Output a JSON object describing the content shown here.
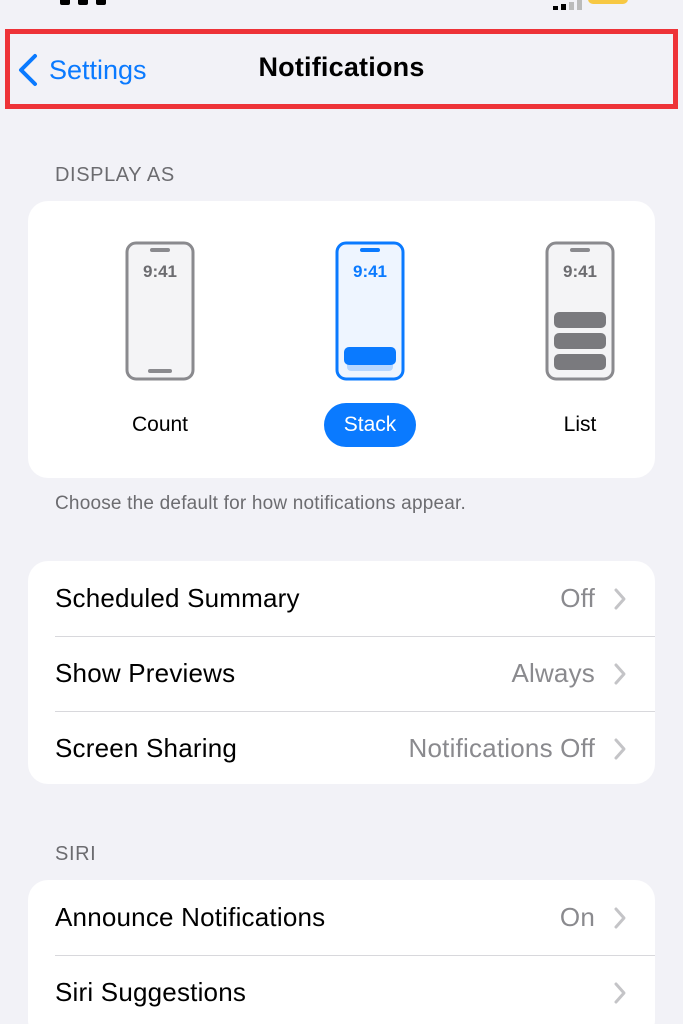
{
  "nav": {
    "back_label": "Settings",
    "title": "Notifications"
  },
  "display_as": {
    "header": "DISPLAY AS",
    "time": "9:41",
    "options": [
      {
        "label": "Count",
        "selected": false
      },
      {
        "label": "Stack",
        "selected": true
      },
      {
        "label": "List",
        "selected": false
      }
    ],
    "footer": "Choose the default for how notifications appear."
  },
  "preferences": {
    "rows": [
      {
        "label": "Scheduled Summary",
        "value": "Off"
      },
      {
        "label": "Show Previews",
        "value": "Always"
      },
      {
        "label": "Screen Sharing",
        "value": "Notifications Off"
      }
    ]
  },
  "siri": {
    "header": "SIRI",
    "rows": [
      {
        "label": "Announce Notifications",
        "value": "On"
      },
      {
        "label": "Siri Suggestions",
        "value": ""
      }
    ]
  },
  "colors": {
    "accent": "#0a7aff",
    "highlight_border": "#ee3338",
    "background": "#f2f2f7",
    "secondary_text": "#8a8a8e"
  }
}
